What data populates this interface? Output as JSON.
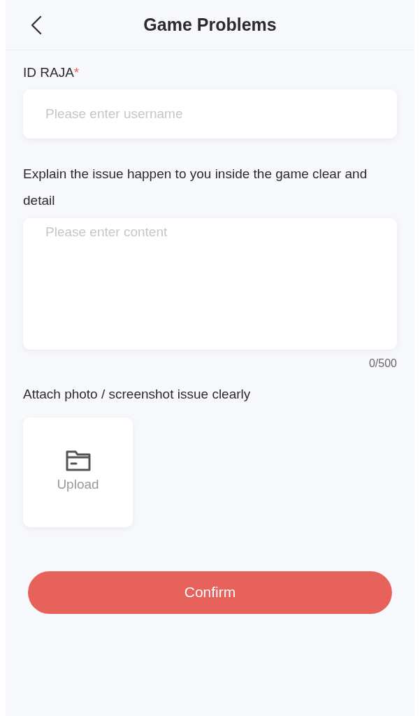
{
  "header": {
    "title": "Game Problems"
  },
  "id_field": {
    "label": "ID RAJA",
    "required_mark": "*",
    "placeholder": "Please enter username"
  },
  "issue_field": {
    "label": "Explain the issue happen to you inside the game clear and detail",
    "placeholder": "Please enter content",
    "counter": "0/500"
  },
  "attach": {
    "label": "Attach photo / screenshot issue clearly",
    "upload": "Upload"
  },
  "confirm": "Confirm"
}
